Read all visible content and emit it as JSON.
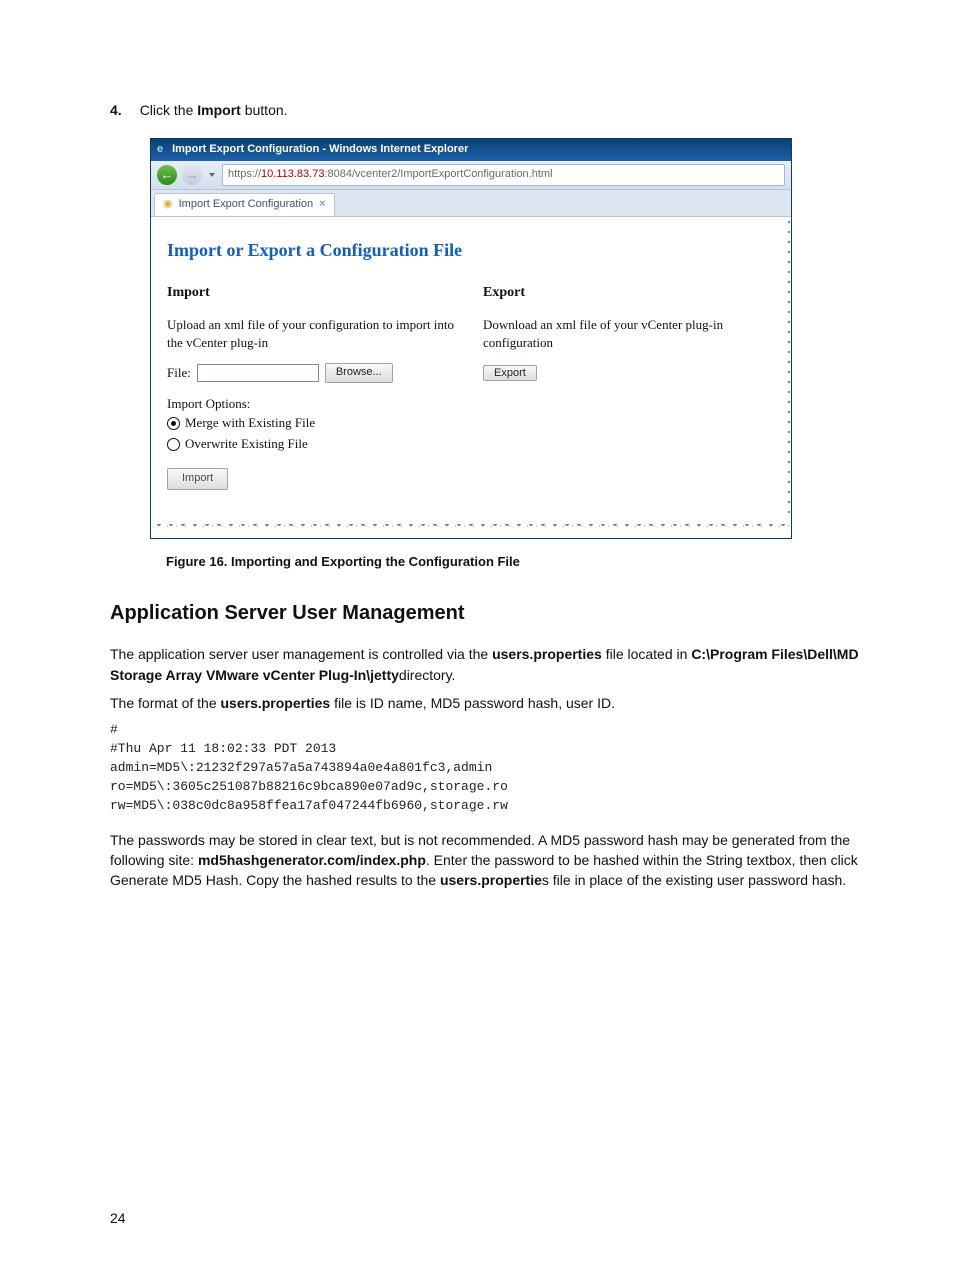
{
  "step": {
    "num": "4.",
    "prefix": "Click the ",
    "bold": "Import",
    "suffix": " button."
  },
  "ie": {
    "title": "Import Export Configuration - Windows Internet Explorer",
    "url_proto": "https://",
    "url_host": "10.113.83.73",
    "url_rest": ":8084/vcenter2/ImportExportConfiguration.html",
    "tab_label": "Import Export Configuration",
    "heading": "Import or Export a Configuration File",
    "imp_h": "Import",
    "imp_desc": "Upload an xml file of your configuration to import into the vCenter plug-in",
    "file_label": "File:",
    "browse_label": "Browse...",
    "options_h": "Import Options:",
    "radio_merge": "Merge with Existing File",
    "radio_over": "Overwrite Existing File",
    "import_btn": "Import",
    "exp_h": "Export",
    "exp_desc": "Download an xml file of your vCenter plug-in configuration",
    "export_btn": "Export"
  },
  "fig_caption": "Figure 16. Importing and Exporting the Configuration File",
  "sec_h2": "Application Server User Management",
  "p1_a": "The application server user management is controlled via the ",
  "p1_b": "users.properties",
  "p1_c": " file located in ",
  "p1_d": "C:\\Program Files\\Dell\\MD Storage Array VMware vCenter Plug-In\\jetty",
  "p1_e": "directory.",
  "p2_a": "The format of the ",
  "p2_b": "users.properties",
  "p2_c": " file is ID name, MD5 password hash, user ID.",
  "code": "#\n#Thu Apr 11 18:02:33 PDT 2013\nadmin=MD5\\:21232f297a57a5a743894a0e4a801fc3,admin\nro=MD5\\:3605c251087b88216c9bca890e07ad9c,storage.ro\nrw=MD5\\:038c0dc8a958ffea17af047244fb6960,storage.rw",
  "p3_a": "The passwords may be stored in clear text, but is not recommended. A MD5 password hash may be generated from the following site: ",
  "p3_b": "md5hashgenerator.com/index.php",
  "p3_c": ". Enter the password to be hashed within the String textbox, then click Generate MD5 Hash. Copy the hashed results to the ",
  "p3_d": "users.propertie",
  "p3_e": "s file in place of the existing user password hash.",
  "pagenum": "24"
}
